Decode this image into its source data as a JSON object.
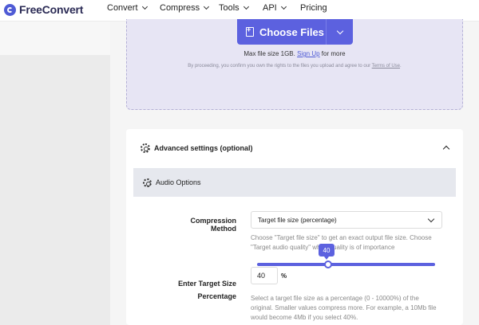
{
  "brand": {
    "name": "FreeConvert"
  },
  "nav": {
    "items": [
      {
        "label": "Convert",
        "dropdown": true
      },
      {
        "label": "Compress",
        "dropdown": true
      },
      {
        "label": "Tools",
        "dropdown": true
      },
      {
        "label": "API",
        "dropdown": true
      },
      {
        "label": "Pricing",
        "dropdown": false
      }
    ]
  },
  "upload": {
    "button_label": "Choose Files",
    "max_size_text": "Max file size 1GB.",
    "signup_link": "Sign Up",
    "max_size_suffix": "for more",
    "consent_text": "By proceeding, you confirm you own the rights to the files you upload and agree to our",
    "terms_link": "Terms of Use",
    "consent_end": "."
  },
  "settings": {
    "header": "Advanced settings (optional)",
    "section": "Audio Options",
    "compression": {
      "label": "Compression Method",
      "selected": "Target file size (percentage)",
      "help": "Choose \"Target file size\" to get an exact output file size. Choose \"Target audio quality\" when quality is of importance"
    },
    "target": {
      "label": "Enter Target Size Percentage",
      "slider_value": 40,
      "value": "40",
      "unit": "%",
      "help": "Select a target file size as a percentage (0 - 10000%) of the original. Smaller values compress more. For example, a 10Mb file would become 4Mb if you select 40%."
    }
  },
  "colors": {
    "accent": "#5c61df",
    "upload_bg": "#e7e5f4"
  }
}
